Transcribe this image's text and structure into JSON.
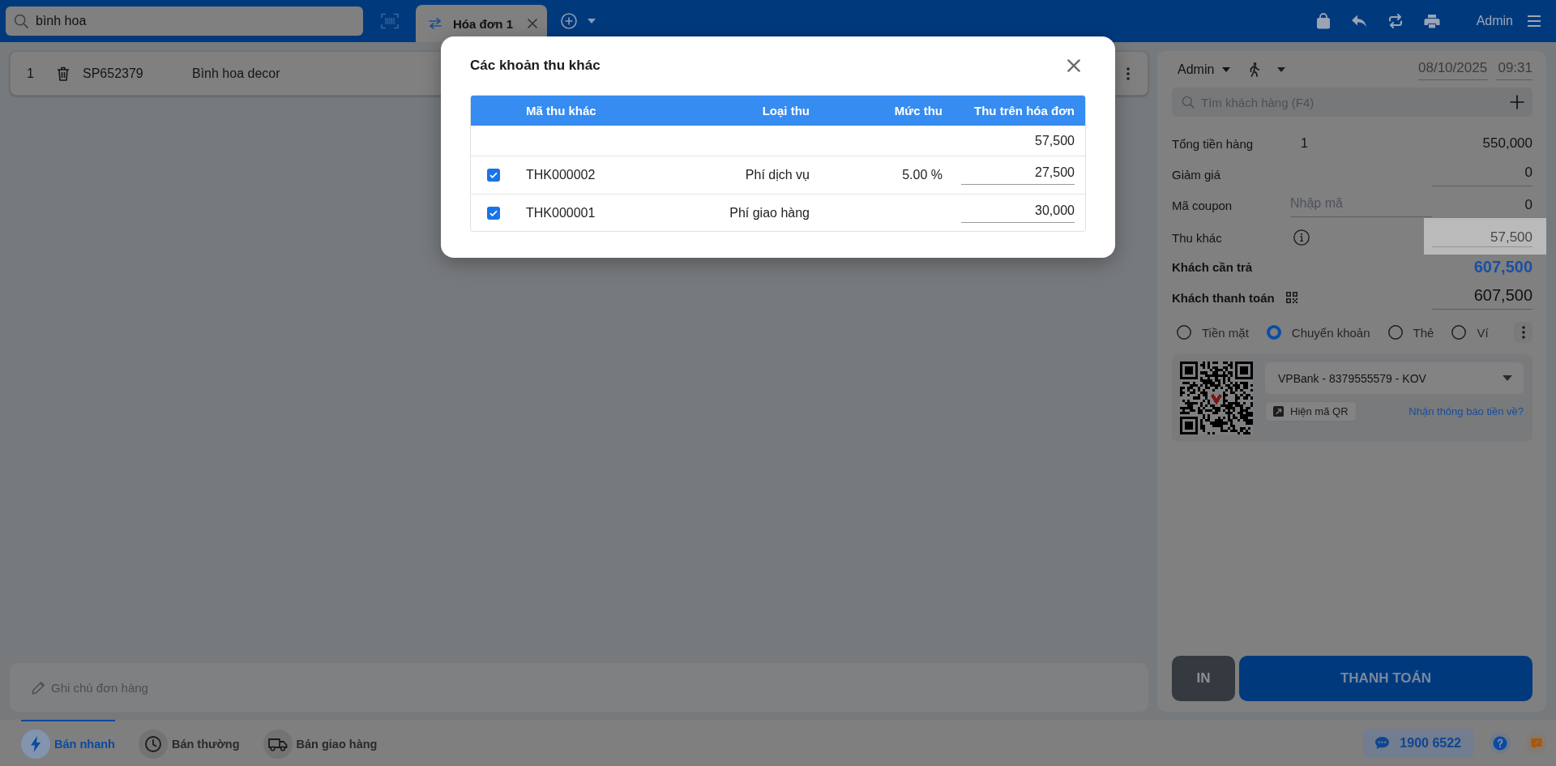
{
  "top_bar": {
    "search": {
      "value": "bình hoa"
    },
    "tabs": [
      {
        "label": "Hóa đơn 1",
        "selected": true
      }
    ],
    "user": "Admin"
  },
  "order_lines": [
    {
      "index": "1",
      "code": "SP652379",
      "name": "Bình hoa decor"
    }
  ],
  "order_note": {
    "placeholder": "Ghi chú đơn hàng"
  },
  "checkout": {
    "seller": "Admin",
    "date": "08/10/2025",
    "time": "09:31",
    "customer_search": {
      "placeholder": "Tìm khách hàng (F4)"
    },
    "summary": [
      {
        "kind": "count",
        "label": "Tổng tiền hàng",
        "count": "1",
        "value": "550,000"
      },
      {
        "kind": "input",
        "label": "Giảm giá",
        "value": "0"
      },
      {
        "kind": "coupon",
        "label": "Mã coupon",
        "placeholder": "Nhập mã",
        "value": "0"
      },
      {
        "kind": "info",
        "label": "Thu khác",
        "value": "57,500",
        "highlighted": true
      },
      {
        "kind": "total",
        "label": "Khách cần trả",
        "value": "607,500"
      },
      {
        "kind": "payment",
        "label": "Khách thanh toán",
        "value": "607,500"
      }
    ],
    "payment_methods": [
      {
        "label": "Tiền mặt",
        "selected": false
      },
      {
        "label": "Chuyển khoản",
        "selected": true
      },
      {
        "label": "Thẻ",
        "selected": false
      },
      {
        "label": "Ví",
        "selected": false
      }
    ],
    "bank_transfer": {
      "account": "VPBank - 8379555579 - KOV",
      "show_qr_button": "Hiện mã QR",
      "notify_link": "Nhận thông báo tiền về?"
    },
    "actions": [
      {
        "kind": "secondary",
        "label": "IN"
      },
      {
        "kind": "primary",
        "label": "THANH TOÁN"
      }
    ]
  },
  "footer": {
    "sale_modes": [
      {
        "kind": "quick",
        "label": "Bán nhanh",
        "selected": true
      },
      {
        "kind": "regular",
        "label": "Bán thường",
        "selected": false
      },
      {
        "kind": "delivery",
        "label": "Bán giao hàng",
        "selected": false
      }
    ],
    "hotline": "1900 6522"
  },
  "modal": {
    "title": "Các khoản thu khác",
    "columns": [
      "Mã thu khác",
      "Loại thu",
      "Mức thu",
      "Thu trên hóa đơn"
    ],
    "total": "57,500",
    "rows": [
      {
        "checked": true,
        "code": "THK000002",
        "type": "Phí dịch vụ",
        "rate": "5.00 %",
        "amount": "27,500"
      },
      {
        "checked": true,
        "code": "THK000001",
        "type": "Phí giao hàng",
        "amount": "30,000"
      }
    ]
  }
}
